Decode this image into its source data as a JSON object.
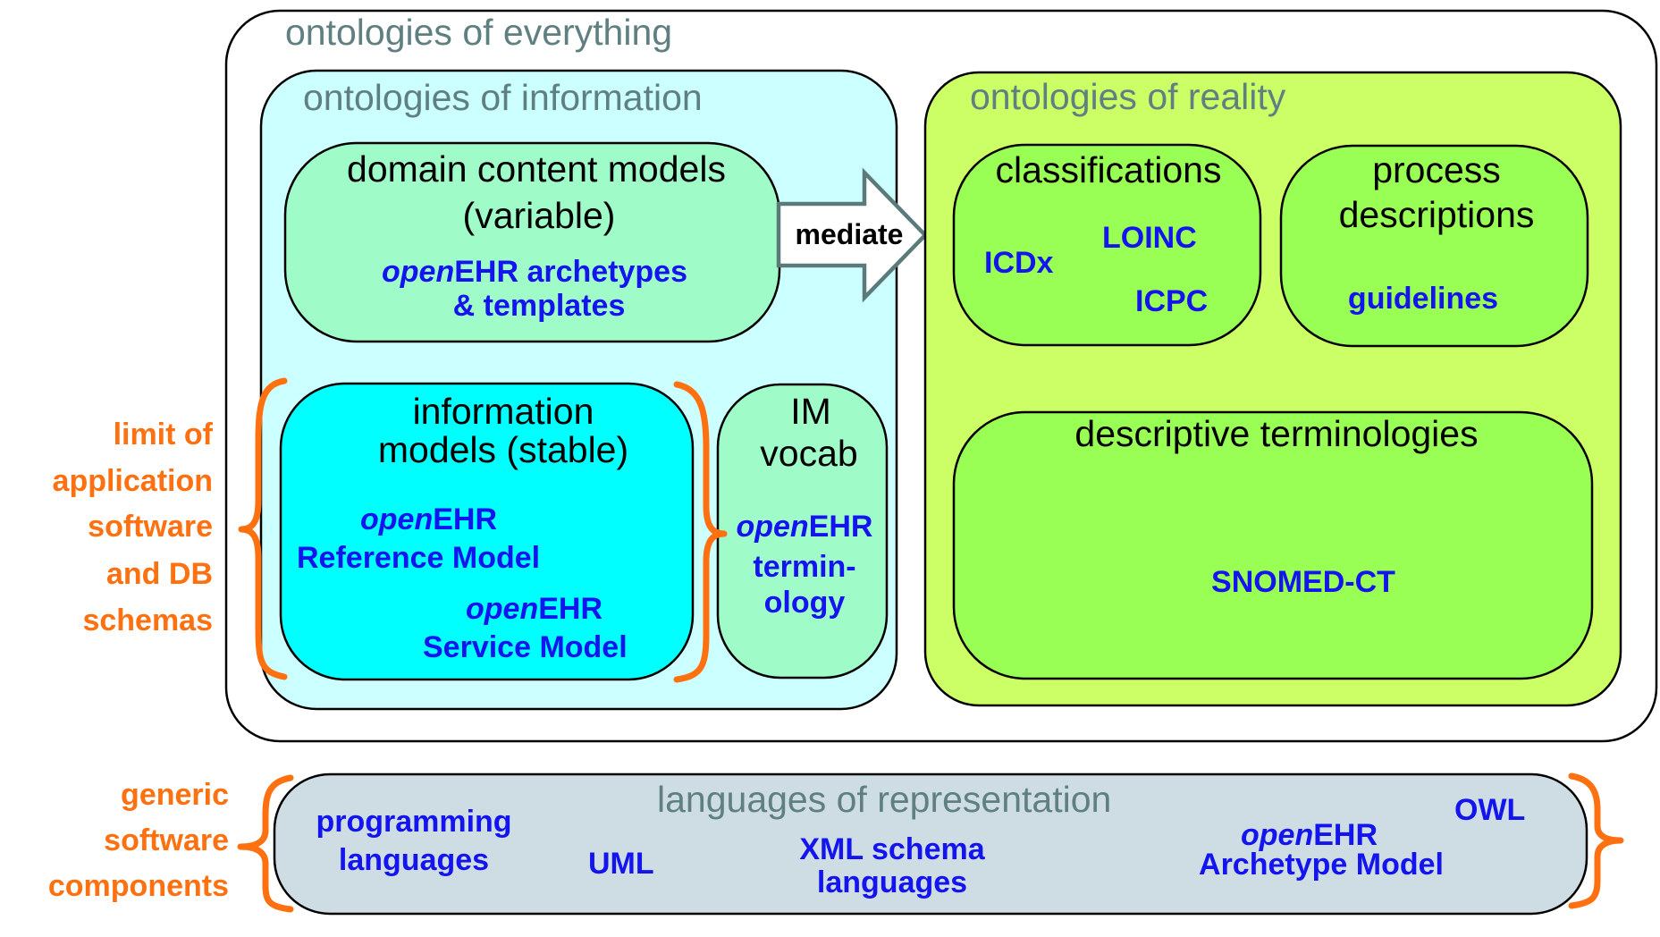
{
  "colors": {
    "everything_fill": "#ffffff",
    "information_fill": "#ccffff",
    "domain_models_fill": "#9ffcc9",
    "information_models_fill": "#00ffff",
    "im_vocab_fill": "#9ffcc9",
    "reality_fill": "#ccff66",
    "reality_inner_fill": "#99ff55",
    "languages_fill": "#cddde3",
    "label_gray": "#5f7f80",
    "term_blue": "#1414ee",
    "brace_orange": "#ff7010",
    "arrow_stroke": "#5b7b7b"
  },
  "everything": {
    "title": "ontologies of everything"
  },
  "information": {
    "title": "ontologies of information",
    "domain_models": {
      "title_line1": "domain content models",
      "title_line2": "(variable)",
      "example_line1_italic": "open",
      "example_line1_rest": "EHR archetypes",
      "example_line2": "& templates"
    },
    "information_models": {
      "title_line1": "information",
      "title_line2": "models (stable)",
      "rm_italic": "open",
      "rm_rest": "EHR",
      "rm_line2": "Reference Model",
      "sm_italic": "open",
      "sm_rest": "EHR",
      "sm_line2": "Service Model"
    },
    "im_vocab": {
      "title_line1": "IM",
      "title_line2": "vocab",
      "example_italic": "open",
      "example_rest": "EHR",
      "example_line2": "termin-",
      "example_line3": "ology"
    }
  },
  "arrow": {
    "label": "mediate"
  },
  "reality": {
    "title": "ontologies of reality",
    "classifications": {
      "title": "classifications",
      "items": [
        "ICDx",
        "LOINC",
        "ICPC"
      ]
    },
    "process_descriptions": {
      "title_line1": "process",
      "title_line2": "descriptions",
      "items": [
        "guidelines"
      ]
    },
    "descriptive_terminologies": {
      "title": "descriptive terminologies",
      "items": [
        "SNOMED-CT"
      ]
    }
  },
  "languages": {
    "title": "languages of representation",
    "programming_line1": "programming",
    "programming_line2": "languages",
    "uml": "UML",
    "xml_line1": "XML schema",
    "xml_line2": "languages",
    "am_italic": "open",
    "am_rest": "EHR",
    "am_line2": "Archetype Model",
    "owl": "OWL"
  },
  "side_labels": {
    "application_limit": [
      "limit of",
      "application",
      "software",
      "and DB",
      "schemas"
    ],
    "generic_components": [
      "generic",
      "software",
      "components"
    ]
  }
}
